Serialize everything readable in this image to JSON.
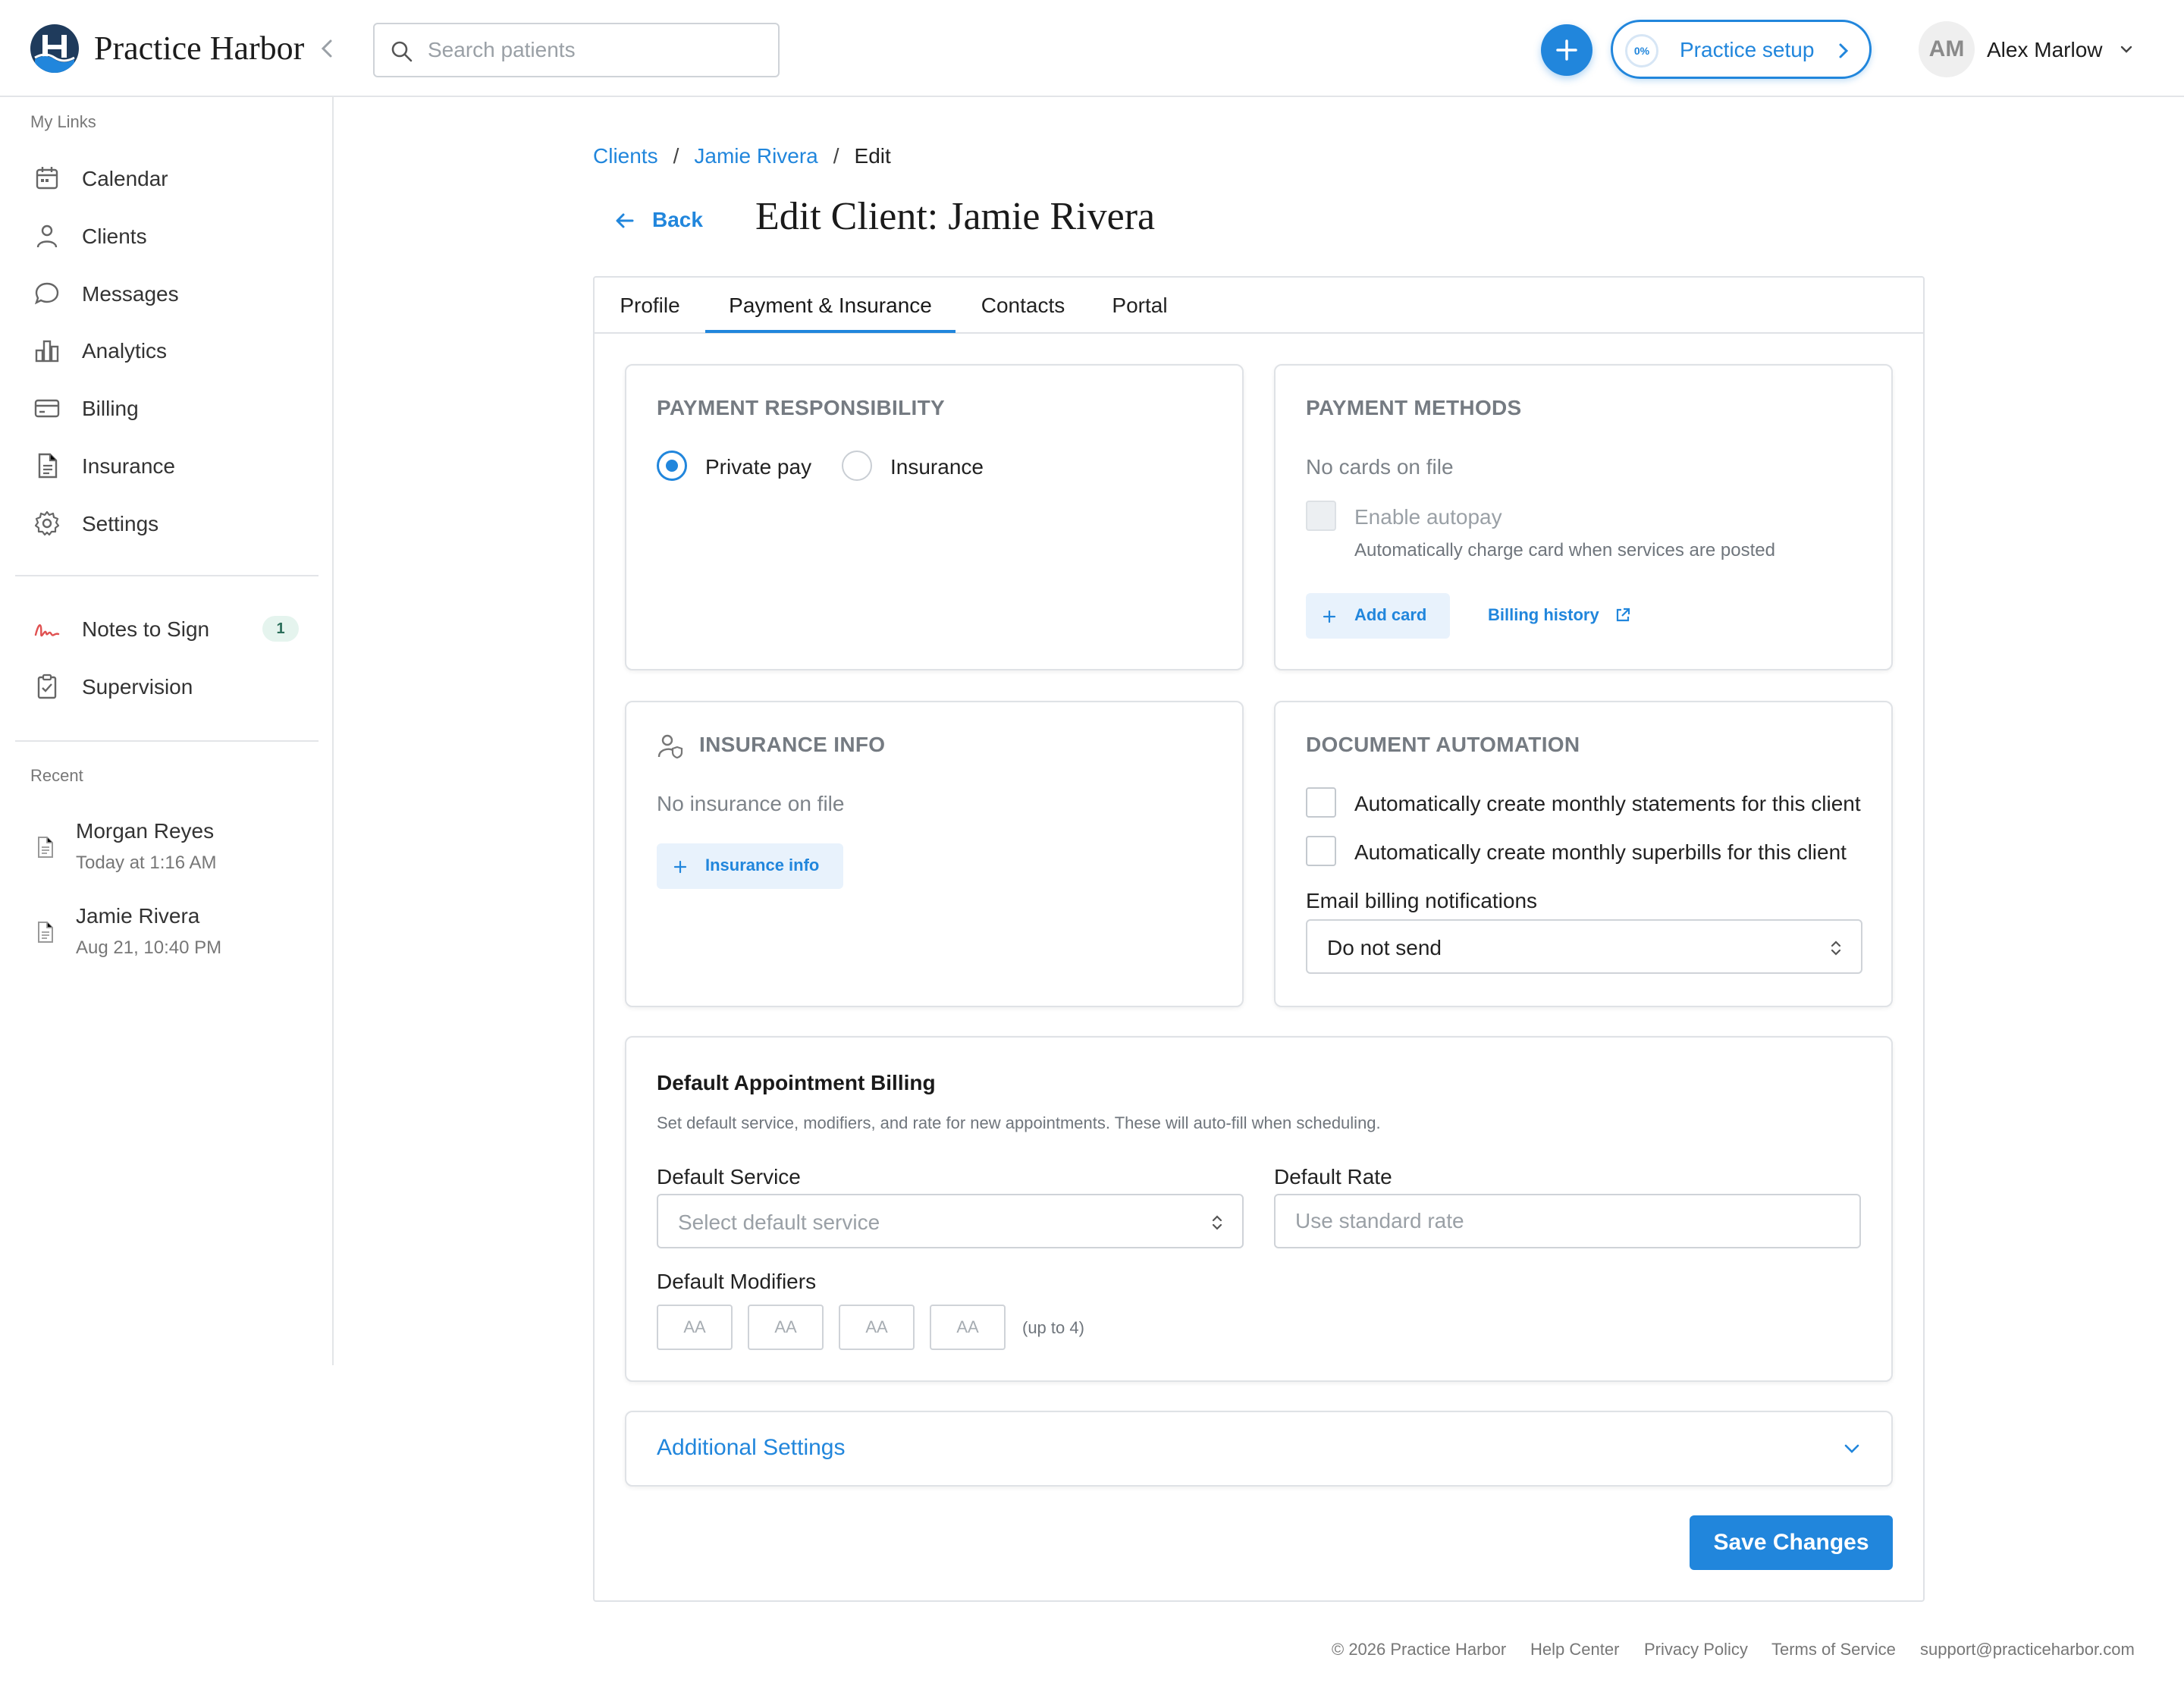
{
  "app": {
    "name": "Practice Harbor",
    "search_placeholder": "Search patients",
    "setup_progress": "0%",
    "setup_label": "Practice setup",
    "user_initials": "AM",
    "user_name": "Alex Marlow"
  },
  "sidebar": {
    "my_links_label": "My Links",
    "items": [
      {
        "label": "Calendar",
        "icon": "calendar-icon"
      },
      {
        "label": "Clients",
        "icon": "user-icon"
      },
      {
        "label": "Messages",
        "icon": "chat-bubble-icon"
      },
      {
        "label": "Analytics",
        "icon": "bar-chart-icon"
      },
      {
        "label": "Billing",
        "icon": "credit-card-icon"
      },
      {
        "label": "Insurance",
        "icon": "document-icon"
      },
      {
        "label": "Settings",
        "icon": "gear-icon"
      }
    ],
    "secondary_items": [
      {
        "label": "Notes to Sign",
        "icon": "signature-icon",
        "badge": "1"
      },
      {
        "label": "Supervision",
        "icon": "clipboard-check-icon"
      }
    ],
    "recent_label": "Recent",
    "recent": [
      {
        "name": "Morgan Reyes",
        "time": "Today at 1:16 AM"
      },
      {
        "name": "Jamie Rivera",
        "time": "Aug 21, 10:40 PM"
      }
    ]
  },
  "page": {
    "breadcrumb": [
      "Clients",
      "Jamie Rivera",
      "Edit"
    ],
    "back_label": "Back",
    "title": "Edit Client: Jamie Rivera",
    "tabs": [
      "Profile",
      "Payment & Insurance",
      "Contacts",
      "Portal"
    ],
    "active_tab": "Payment & Insurance"
  },
  "payment_responsibility": {
    "title": "PAYMENT RESPONSIBILITY",
    "options": [
      "Private pay",
      "Insurance"
    ],
    "selected": "Private pay"
  },
  "payment_methods": {
    "title": "PAYMENT METHODS",
    "empty_text": "No cards on file",
    "autopay_label": "Enable autopay",
    "autopay_hint": "Automatically charge card when services are posted",
    "add_card_label": "Add card",
    "billing_history_label": "Billing history"
  },
  "insurance_info": {
    "title": "INSURANCE INFO",
    "empty_text": "No insurance on file",
    "add_label": "Insurance info"
  },
  "document_automation": {
    "title": "DOCUMENT AUTOMATION",
    "statements_label": "Automatically create monthly statements for this client",
    "superbills_label": "Automatically create monthly superbills for this client",
    "email_label": "Email billing notifications",
    "email_value": "Do not send"
  },
  "default_billing": {
    "title": "Default Appointment Billing",
    "description": "Set default service, modifiers, and rate for new appointments. These will auto-fill when scheduling.",
    "service_label": "Default Service",
    "service_placeholder": "Select default service",
    "rate_label": "Default Rate",
    "rate_placeholder": "Use standard rate",
    "modifiers_label": "Default Modifiers",
    "modifier_placeholder": "AA",
    "modifiers_hint": "(up to 4)"
  },
  "additional_settings_label": "Additional Settings",
  "save_label": "Save Changes",
  "footer": {
    "copyright": "© 2026 Practice Harbor",
    "links": [
      "Help Center",
      "Privacy Policy",
      "Terms of Service"
    ],
    "email": "support@practiceharbor.com"
  },
  "colors": {
    "accent": "#2186dc",
    "brand_dark": "#1f3b5c",
    "border": "#dfe2e6",
    "muted_text": "#7d8389"
  }
}
